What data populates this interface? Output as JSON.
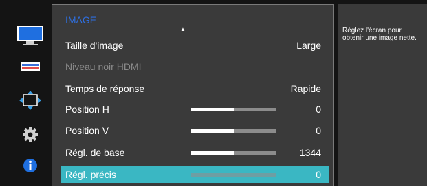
{
  "menu": {
    "title": "IMAGE",
    "items": [
      {
        "label": "Taille d'image",
        "value": "Large",
        "type": "value"
      },
      {
        "label": "Niveau noir HDMI",
        "value": "",
        "type": "disabled"
      },
      {
        "label": "Temps de réponse",
        "value": "Rapide",
        "type": "value"
      },
      {
        "label": "Position H",
        "value": "0",
        "type": "slider",
        "level": 0.5
      },
      {
        "label": "Position V",
        "value": "0",
        "type": "slider",
        "level": 0.5
      },
      {
        "label": "Régl. de base",
        "value": "1344",
        "type": "slider",
        "level": 0.5
      },
      {
        "label": "Régl. précis",
        "value": "0",
        "type": "slider",
        "level": 0.0,
        "selected": true
      }
    ]
  },
  "help": {
    "text": "Réglez l'écran pour obtenir une image nette."
  },
  "side_icons": [
    "monitor-icon",
    "color-bars-icon",
    "resize-arrows-icon",
    "gear-icon",
    "info-icon"
  ],
  "colors": {
    "accent_title": "#2e6fe0",
    "selection": "#3ab7c3",
    "panel": "#3a3a3a"
  }
}
